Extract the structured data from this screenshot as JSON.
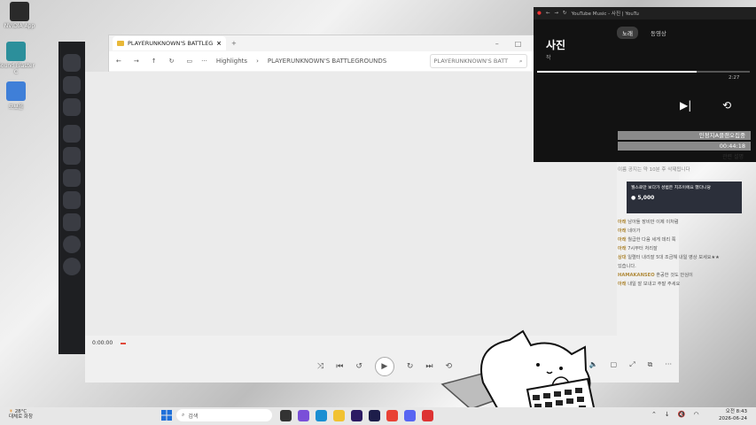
{
  "desktop": {
    "icons": [
      {
        "label": "NVIDIA App"
      },
      {
        "label": "Sound Blaster C"
      },
      {
        "label": "모보폴"
      }
    ]
  },
  "explorer": {
    "tab_title": "PLAYERUNKNOWN'S BATTLEG",
    "crumb_highlights": "Highlights",
    "crumb_folder": "PLAYERUNKNOWN'S BATTLEGROUNDS",
    "search_placeholder": "PLAYERUNKNOWN'S BATT"
  },
  "player": {
    "time": "0:00:00"
  },
  "ytm": {
    "topbar_text": "YouTube Music - 사진 | YouTu",
    "tab_song": "노래",
    "tab_video": "동영상",
    "song_title": "사진",
    "artist": "작",
    "duration": "2:27",
    "progress_fraction": 0.75
  },
  "chat": {
    "title_pill": "인정지A클랜오집중",
    "timer_pill": "00:44:18",
    "subtitle": "관련 설명",
    "system_line": "이름 공지는 약 10분 후 삭제됩니다",
    "donation_text": "월스로만 보다가 성범은 치즈이에요 했다니당",
    "donation_amount": "5,000",
    "messages": [
      {
        "nick": "아래",
        "text": "남아돌 장비만 이제 이처럼"
      },
      {
        "nick": "아래",
        "text": "네이가"
      },
      {
        "nick": "아래",
        "text": "월급한 다음 세게 데리 쭉"
      },
      {
        "nick": "아래",
        "text": "7시부터 처리잘"
      },
      {
        "nick": "상대",
        "text": "일렬터 내리잘 5대 조금해 내일 영상 보세요★★"
      },
      {
        "nick": "",
        "text": "있습니다."
      },
      {
        "nick": "HAMAKANSEO",
        "text": "혼공한 것도 안심이"
      },
      {
        "nick": "아래",
        "text": "내일 잘 보내고 주말 주세요"
      }
    ]
  },
  "taskbar": {
    "temperature": "28°C",
    "weather": "대체로 화창",
    "search_label": "검색",
    "time": "오전 8:43",
    "date": "2026-06-24"
  },
  "colors": {
    "accent_red": "#e0493b",
    "ytm_bg": "#121212",
    "discord_bg": "#1e1f22"
  }
}
